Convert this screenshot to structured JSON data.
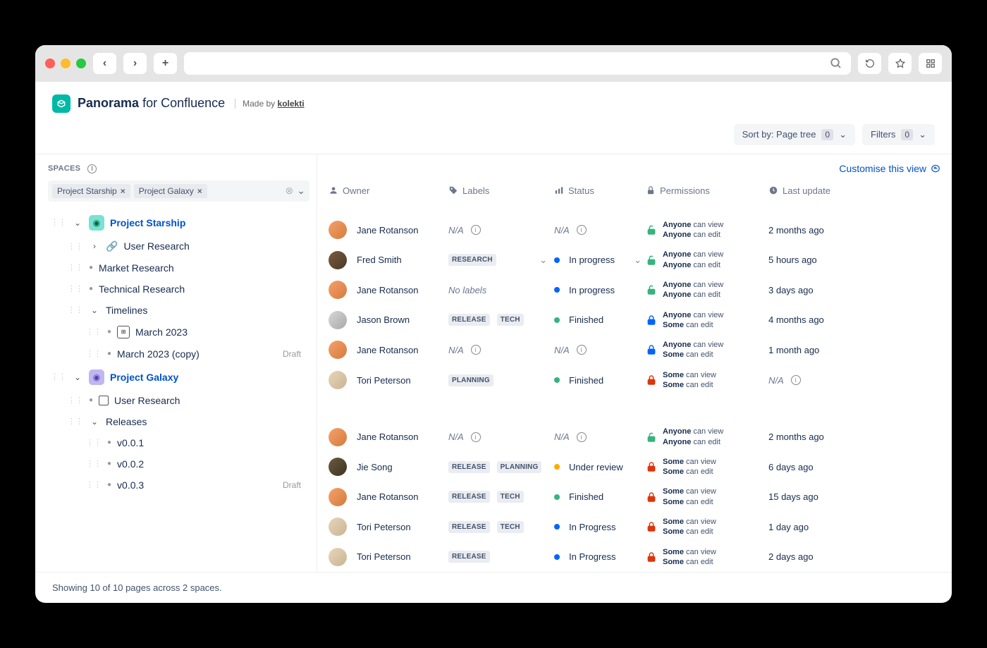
{
  "app": {
    "title_bold": "Panorama",
    "title_light": "for Confluence",
    "made_by_prefix": "Made by",
    "made_by_brand": "kolekti"
  },
  "toolbar": {
    "sort_label": "Sort by: Page tree",
    "sort_count": "0",
    "filters_label": "Filters",
    "filters_count": "0"
  },
  "sidebar": {
    "header": "SPACES",
    "chips": [
      "Project Starship",
      "Project Galaxy"
    ],
    "spaces": [
      {
        "name": "Project Starship",
        "color": "teal",
        "pages": [
          {
            "lvl": 1,
            "caret": ">",
            "icon": "link",
            "name": "User Research"
          },
          {
            "lvl": 1,
            "bullet": true,
            "name": "Market Research"
          },
          {
            "lvl": 1,
            "bullet": true,
            "name": "Technical Research"
          },
          {
            "lvl": 1,
            "caret": "v",
            "name": "Timelines"
          },
          {
            "lvl": 2,
            "bullet": true,
            "icon": "calendar",
            "name": "March 2023"
          },
          {
            "lvl": 2,
            "bullet": true,
            "name": "March 2023 (copy)",
            "draft": true
          }
        ]
      },
      {
        "name": "Project Galaxy",
        "color": "purple",
        "pages": [
          {
            "lvl": 1,
            "bullet": true,
            "icon": "pin",
            "name": "User Research"
          },
          {
            "lvl": 1,
            "caret": "v",
            "name": "Releases"
          },
          {
            "lvl": 2,
            "bullet": true,
            "name": "v0.0.1"
          },
          {
            "lvl": 2,
            "bullet": true,
            "name": "v0.0.2"
          },
          {
            "lvl": 2,
            "bullet": true,
            "name": "v0.0.3",
            "draft": true
          }
        ]
      }
    ],
    "draft_label": "Draft"
  },
  "content": {
    "customize_link": "Customise this view",
    "columns": {
      "owner": "Owner",
      "labels": "Labels",
      "status": "Status",
      "permissions": "Permissions",
      "last_update": "Last update"
    },
    "na": "N/A",
    "no_labels": "No labels",
    "perm_anyone_view": "Anyone",
    "perm_some": "Some",
    "perm_can_view": "can view",
    "perm_can_edit": "can edit",
    "groups": [
      {
        "rows": [
          {
            "owner": "Jane Rotanson",
            "avatar": "jr",
            "labels": null,
            "status": null,
            "lock": "green",
            "view": "Anyone",
            "edit": "Anyone",
            "update": "2 months ago"
          },
          {
            "owner": "Fred Smith",
            "avatar": "fs",
            "labels": [
              "RESEARCH"
            ],
            "labelsDropdown": true,
            "status": "In progress",
            "statusColor": "blue",
            "statusDropdown": true,
            "lock": "green",
            "view": "Anyone",
            "edit": "Anyone",
            "update": "5 hours ago"
          },
          {
            "owner": "Jane Rotanson",
            "avatar": "jr",
            "labels": "none",
            "status": "In progress",
            "statusColor": "blue",
            "lock": "green",
            "view": "Anyone",
            "edit": "Anyone",
            "update": "3 days ago"
          },
          {
            "owner": "Jason Brown",
            "avatar": "jb",
            "labels": [
              "RELEASE",
              "TECH"
            ],
            "status": "Finished",
            "statusColor": "green",
            "lock": "blue",
            "view": "Anyone",
            "edit": "Some",
            "update": "4 months ago"
          },
          {
            "owner": "Jane Rotanson",
            "avatar": "jr",
            "labels": null,
            "status": null,
            "lock": "blue",
            "view": "Anyone",
            "edit": "Some",
            "update": "1 month ago"
          },
          {
            "owner": "Tori Peterson",
            "avatar": "tp",
            "labels": [
              "PLANNING"
            ],
            "status": "Finished",
            "statusColor": "green",
            "lock": "red",
            "view": "Some",
            "edit": "Some",
            "update": null
          }
        ]
      },
      {
        "rows": [
          {
            "owner": "Jane Rotanson",
            "avatar": "jr",
            "labels": null,
            "status": null,
            "lock": "green",
            "view": "Anyone",
            "edit": "Anyone",
            "update": "2 months ago"
          },
          {
            "owner": "Jie Song",
            "avatar": "js",
            "labels": [
              "RELEASE",
              "PLANNING"
            ],
            "status": "Under review",
            "statusColor": "yellow",
            "lock": "red",
            "view": "Some",
            "edit": "Some",
            "update": "6 days ago"
          },
          {
            "owner": "Jane Rotanson",
            "avatar": "jr",
            "labels": [
              "RELEASE",
              "TECH"
            ],
            "status": "Finished",
            "statusColor": "green",
            "lock": "red",
            "view": "Some",
            "edit": "Some",
            "update": "15 days ago"
          },
          {
            "owner": "Tori Peterson",
            "avatar": "tp",
            "labels": [
              "RELEASE",
              "TECH"
            ],
            "status": "In Progress",
            "statusColor": "blue",
            "lock": "red",
            "view": "Some",
            "edit": "Some",
            "update": "1 day ago"
          },
          {
            "owner": "Tori Peterson",
            "avatar": "tp",
            "labels": [
              "RELEASE"
            ],
            "status": "In Progress",
            "statusColor": "blue",
            "lock": "red",
            "view": "Some",
            "edit": "Some",
            "update": "2 days ago"
          }
        ]
      }
    ]
  },
  "footer": {
    "text": "Showing 10 of 10 pages across 2 spaces."
  },
  "avatars": {
    "jr": "linear-gradient(135deg,#f6a16c,#d47b3c)",
    "fs": "linear-gradient(135deg,#7b5c3e,#4a3829)",
    "jb": "linear-gradient(135deg,#d8d8d8,#a8a8a8)",
    "tp": "linear-gradient(135deg,#e8d4b8,#c9b594)",
    "js": "linear-gradient(135deg,#6b5b3f,#3d3424)"
  }
}
